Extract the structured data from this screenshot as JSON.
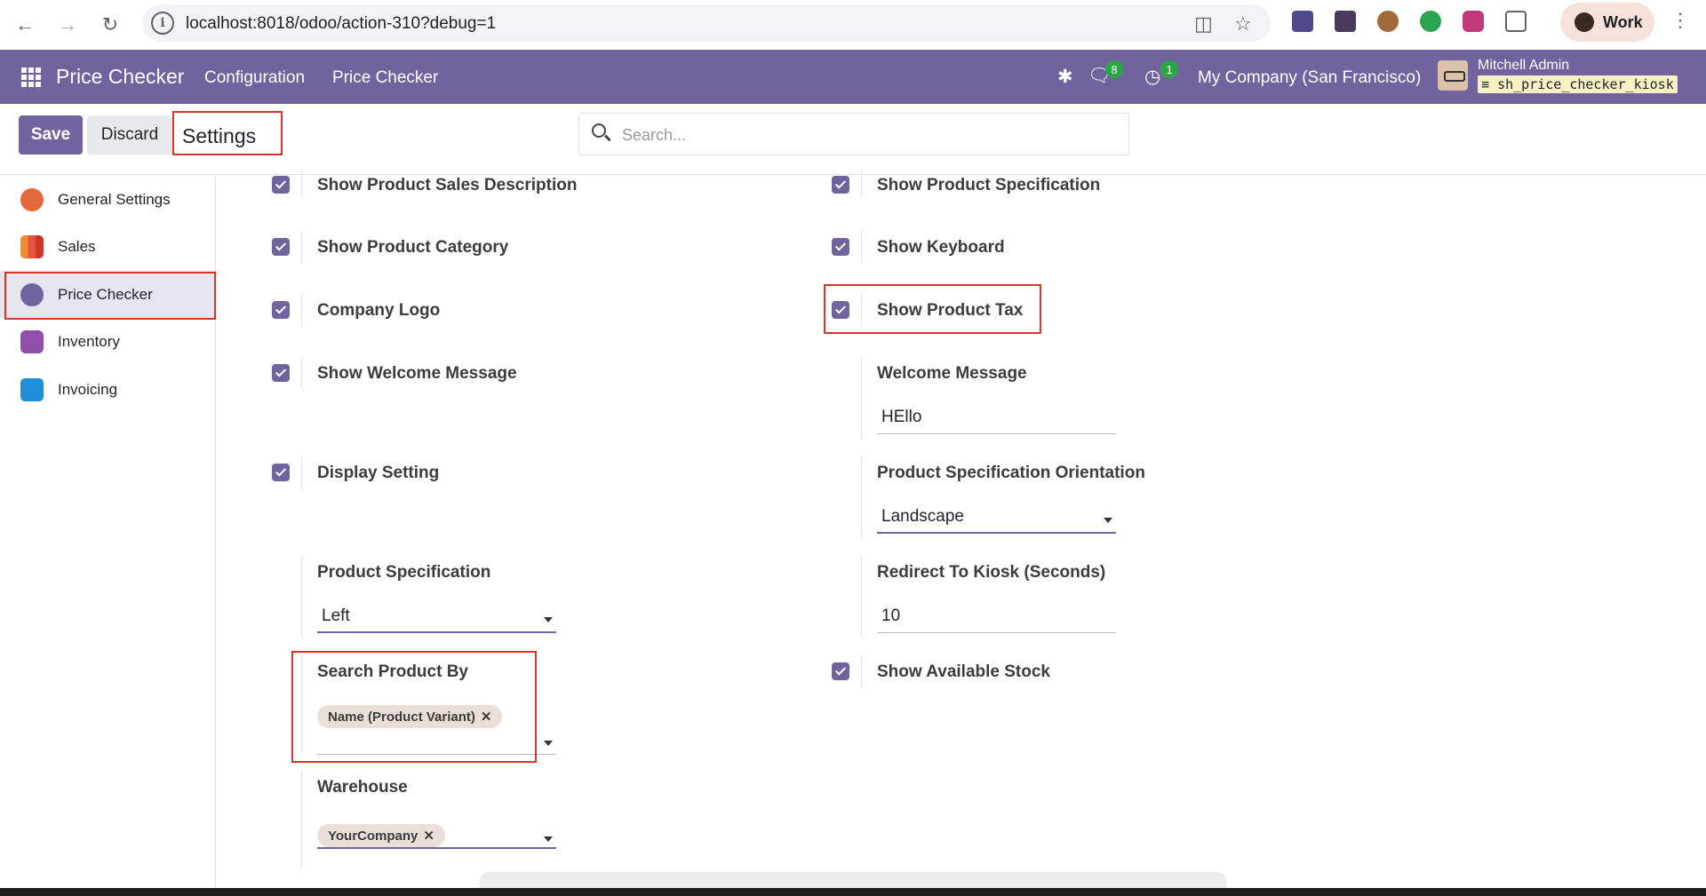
{
  "browser": {
    "url": "localhost:8018/odoo/action-310?debug=1",
    "profile_label": "Work"
  },
  "navbar": {
    "app_name": "Price Checker",
    "menus": [
      "Configuration",
      "Price Checker"
    ],
    "messages_count": "8",
    "activities_count": "1",
    "company": "My Company (San Francisco)",
    "user_name": "Mitchell Admin",
    "database": "sh_price_checker_kiosk"
  },
  "control_panel": {
    "save_label": "Save",
    "discard_label": "Discard",
    "breadcrumb": "Settings",
    "search_placeholder": "Search..."
  },
  "sidebar": {
    "items": [
      {
        "label": "General Settings",
        "icon": "general-settings-icon",
        "color": "#e4693a"
      },
      {
        "label": "Sales",
        "icon": "sales-icon",
        "color": "#f08c2e"
      },
      {
        "label": "Price Checker",
        "icon": "price-checker-icon",
        "color": "#71639e",
        "active": true
      },
      {
        "label": "Inventory",
        "icon": "inventory-icon",
        "color": "#8e4fa8"
      },
      {
        "label": "Invoicing",
        "icon": "invoicing-icon",
        "color": "#1f8fd8"
      }
    ]
  },
  "settings": {
    "show_product_sales_description": "Show Product Sales Description",
    "show_product_specification": "Show Product Specification",
    "show_product_category": "Show Product Category",
    "show_keyboard": "Show Keyboard",
    "company_logo": "Company Logo",
    "show_product_tax": "Show Product Tax",
    "show_welcome_message": "Show Welcome Message",
    "welcome_message_label": "Welcome Message",
    "welcome_message_value": "HEllo",
    "display_setting": "Display Setting",
    "spec_orientation_label": "Product Specification Orientation",
    "spec_orientation_value": "Landscape",
    "product_spec_label": "Product Specification",
    "product_spec_value": "Left",
    "redirect_label": "Redirect To Kiosk (Seconds)",
    "redirect_value": "10",
    "search_by_label": "Search Product By",
    "search_by_tag": "Name (Product Variant)",
    "show_available_stock": "Show Available Stock",
    "warehouse_label": "Warehouse",
    "warehouse_tag": "YourCompany"
  },
  "colors": {
    "brand": "#71639e",
    "highlight": "#d9332c"
  }
}
